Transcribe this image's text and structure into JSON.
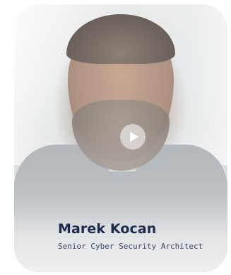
{
  "profile": {
    "name": "Marek Kocan",
    "role": "Senior Cyber Security Architect"
  },
  "video": {
    "play_icon": "play-icon"
  },
  "colors": {
    "name_text": "#1d2c4d",
    "role_text": "#37486b"
  }
}
